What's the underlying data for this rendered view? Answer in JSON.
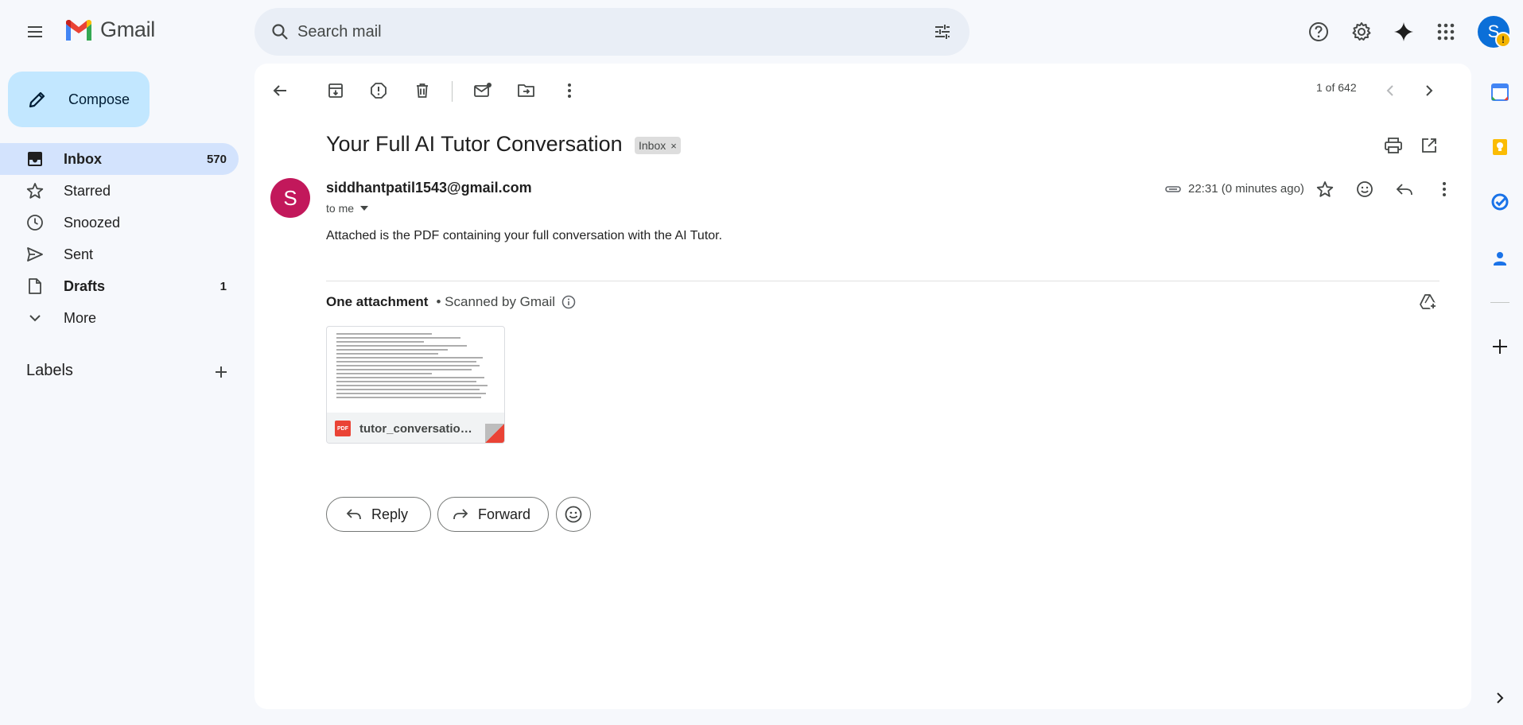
{
  "app": {
    "name": "Gmail"
  },
  "search": {
    "placeholder": "Search mail"
  },
  "header_icons": [
    "support-icon",
    "settings-icon",
    "gemini-icon",
    "apps-grid-icon"
  ],
  "account": {
    "initial": "S",
    "badge": "!"
  },
  "compose": {
    "label": "Compose"
  },
  "sidebar": {
    "items": [
      {
        "label": "Inbox",
        "count": "570",
        "icon": "inbox-icon",
        "active": true,
        "bold": true
      },
      {
        "label": "Starred",
        "count": "",
        "icon": "star-icon",
        "active": false,
        "bold": false
      },
      {
        "label": "Snoozed",
        "count": "",
        "icon": "clock-icon",
        "active": false,
        "bold": false
      },
      {
        "label": "Sent",
        "count": "",
        "icon": "send-icon",
        "active": false,
        "bold": false
      },
      {
        "label": "Drafts",
        "count": "1",
        "icon": "draft-icon",
        "active": false,
        "bold": true
      },
      {
        "label": "More",
        "count": "",
        "icon": "chevron-down-icon",
        "active": false,
        "bold": false
      }
    ],
    "labels_heading": "Labels"
  },
  "toolbar": {
    "pager": "1 of 642"
  },
  "email": {
    "subject": "Your Full AI Tutor Conversation",
    "label_chip": "Inbox",
    "chip_close": "×",
    "sender_initial": "S",
    "sender": "siddhantpatil1543@gmail.com",
    "recipient": "to me",
    "time": "22:31 (0 minutes ago)",
    "body": "Attached is the PDF containing your full conversation with the AI Tutor."
  },
  "attachments": {
    "heading": "One attachment",
    "scanned": "• Scanned by Gmail",
    "file": {
      "name": "tutor_conversation.pdf",
      "type_badge": "PDF"
    }
  },
  "actions": {
    "reply": "Reply",
    "forward": "Forward"
  },
  "colors": {
    "accent": "#0b57d0",
    "compose_bg": "#c2e7ff",
    "active_nav": "#d3e3fd",
    "sender_avatar": "#c2185b",
    "pdf_red": "#ea4335"
  }
}
